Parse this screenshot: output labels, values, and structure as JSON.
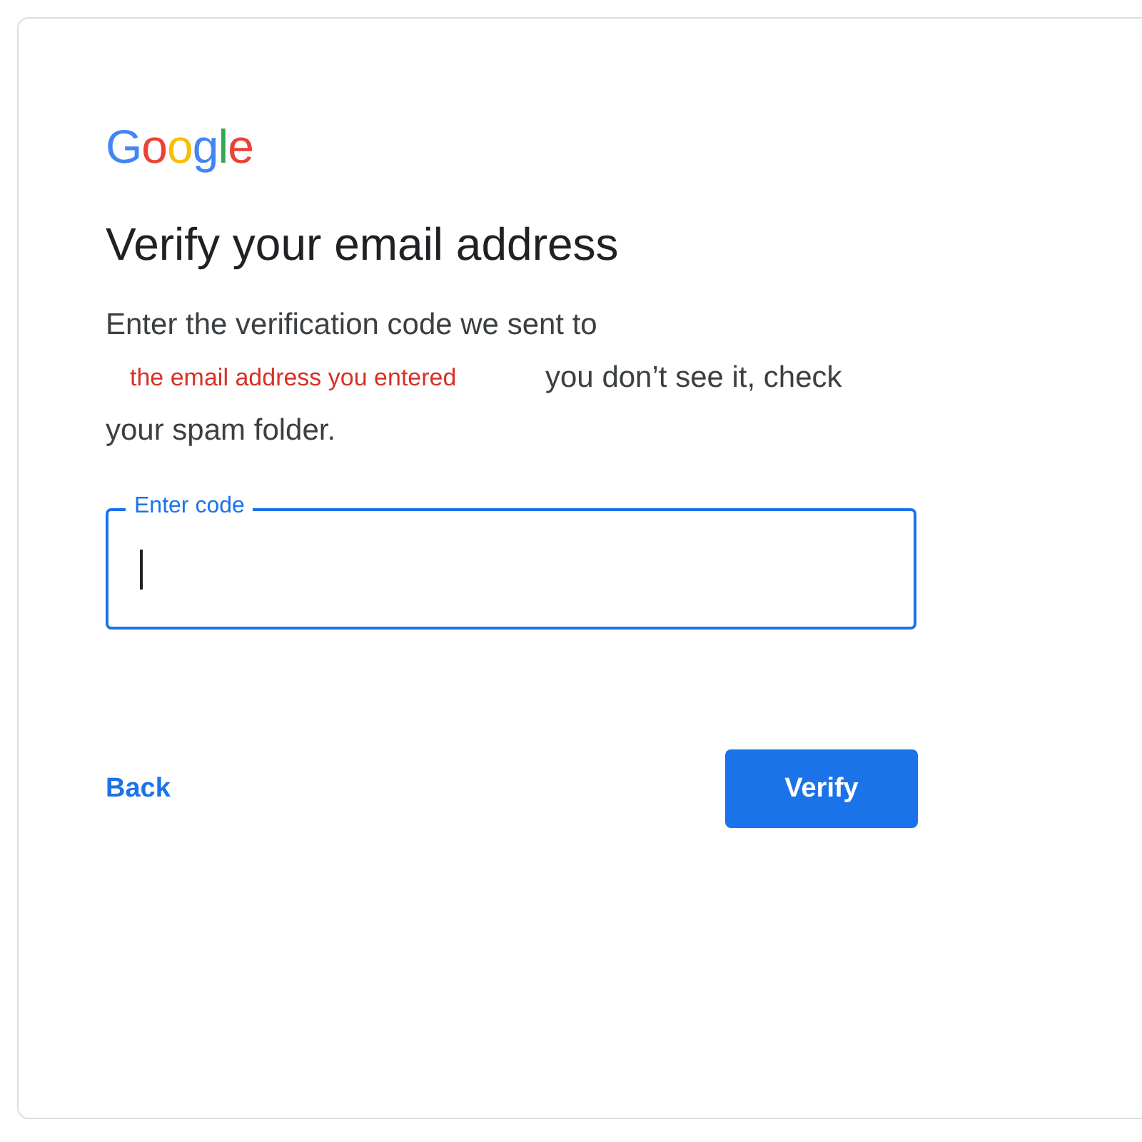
{
  "logo": [
    {
      "text": "G",
      "color": "#4285f4"
    },
    {
      "text": "o",
      "color": "#ea4335"
    },
    {
      "text": "o",
      "color": "#fbbc05"
    },
    {
      "text": "g",
      "color": "#4285f4"
    },
    {
      "text": "l",
      "color": "#34a853"
    },
    {
      "text": "e",
      "color": "#ea4335"
    }
  ],
  "title": "Verify your email address",
  "message": {
    "line_1": "Enter the verification code we sent to",
    "annotation": "the email address you entered",
    "line_2": "you don’t see it, check",
    "line_3": "your spam folder."
  },
  "code_field": {
    "label": "Enter code",
    "focused": true
  },
  "buttons": [
    {
      "kind": "text",
      "label": "Back"
    },
    {
      "kind": "filled",
      "label": "Verify"
    }
  ]
}
